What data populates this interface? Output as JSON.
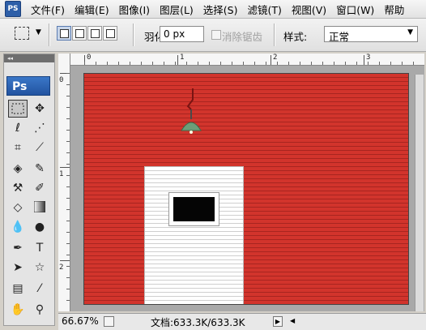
{
  "menubar": {
    "items": [
      "文件(F)",
      "编辑(E)",
      "图像(I)",
      "图层(L)",
      "选择(S)",
      "滤镜(T)",
      "视图(V)",
      "窗口(W)",
      "帮助"
    ]
  },
  "options": {
    "feather_label": "羽化:",
    "feather_value": "0 px",
    "antialias_label": "消除锯齿",
    "style_label": "样式:",
    "style_value": "正常"
  },
  "toolbox": {
    "logo": "Ps",
    "tools": [
      "marquee",
      "move",
      "lasso",
      "magic-wand",
      "crop",
      "slice",
      "healing-brush",
      "brush",
      "clone-stamp",
      "history-brush",
      "eraser",
      "gradient",
      "blur",
      "dodge",
      "pen",
      "type",
      "path-selection",
      "shape",
      "notes",
      "eyedropper",
      "hand",
      "zoom"
    ]
  },
  "rulers": {
    "top": [
      "0",
      "1",
      "2",
      "3"
    ],
    "left": [
      "0",
      "1",
      "2"
    ]
  },
  "status": {
    "zoom": "66.67%",
    "doc": "文档:633.3K/633.3K"
  },
  "colors": {
    "barn_red": "#d2342c",
    "door_white": "#ffffff",
    "lamp_green": "#6c9e78"
  }
}
